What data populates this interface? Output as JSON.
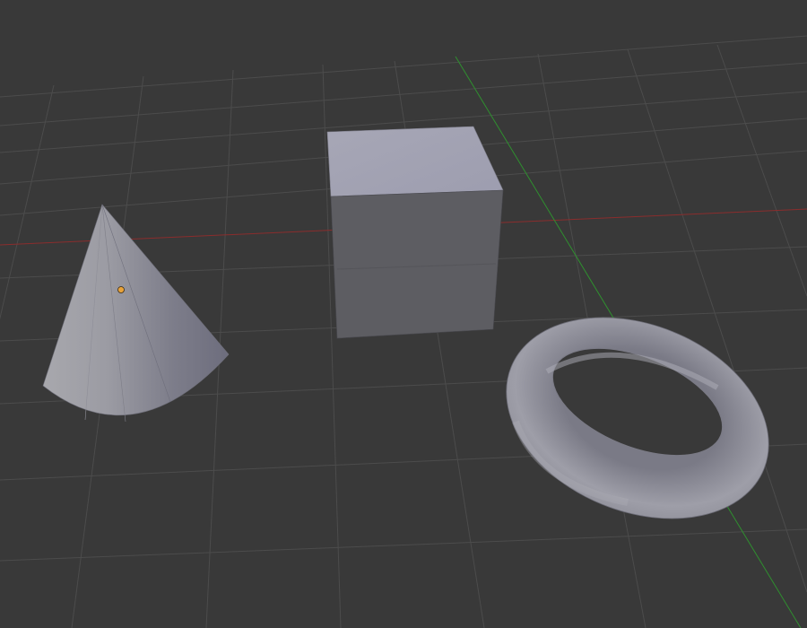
{
  "viewport": {
    "background_color": "#393939",
    "grid_line_color": "#4b4b4b",
    "x_axis_color": "#8a2d2d",
    "y_axis_color": "#2f8f2f"
  },
  "scene": {
    "objects": [
      {
        "name": "cone",
        "shape": "cone",
        "selected": false
      },
      {
        "name": "cube",
        "shape": "cube",
        "selected": false
      },
      {
        "name": "torus",
        "shape": "torus",
        "selected": false
      }
    ],
    "origin_marker": {
      "of_object": "cone",
      "color": "#e8a23a"
    },
    "mesh_color": "#9a9aa6"
  }
}
